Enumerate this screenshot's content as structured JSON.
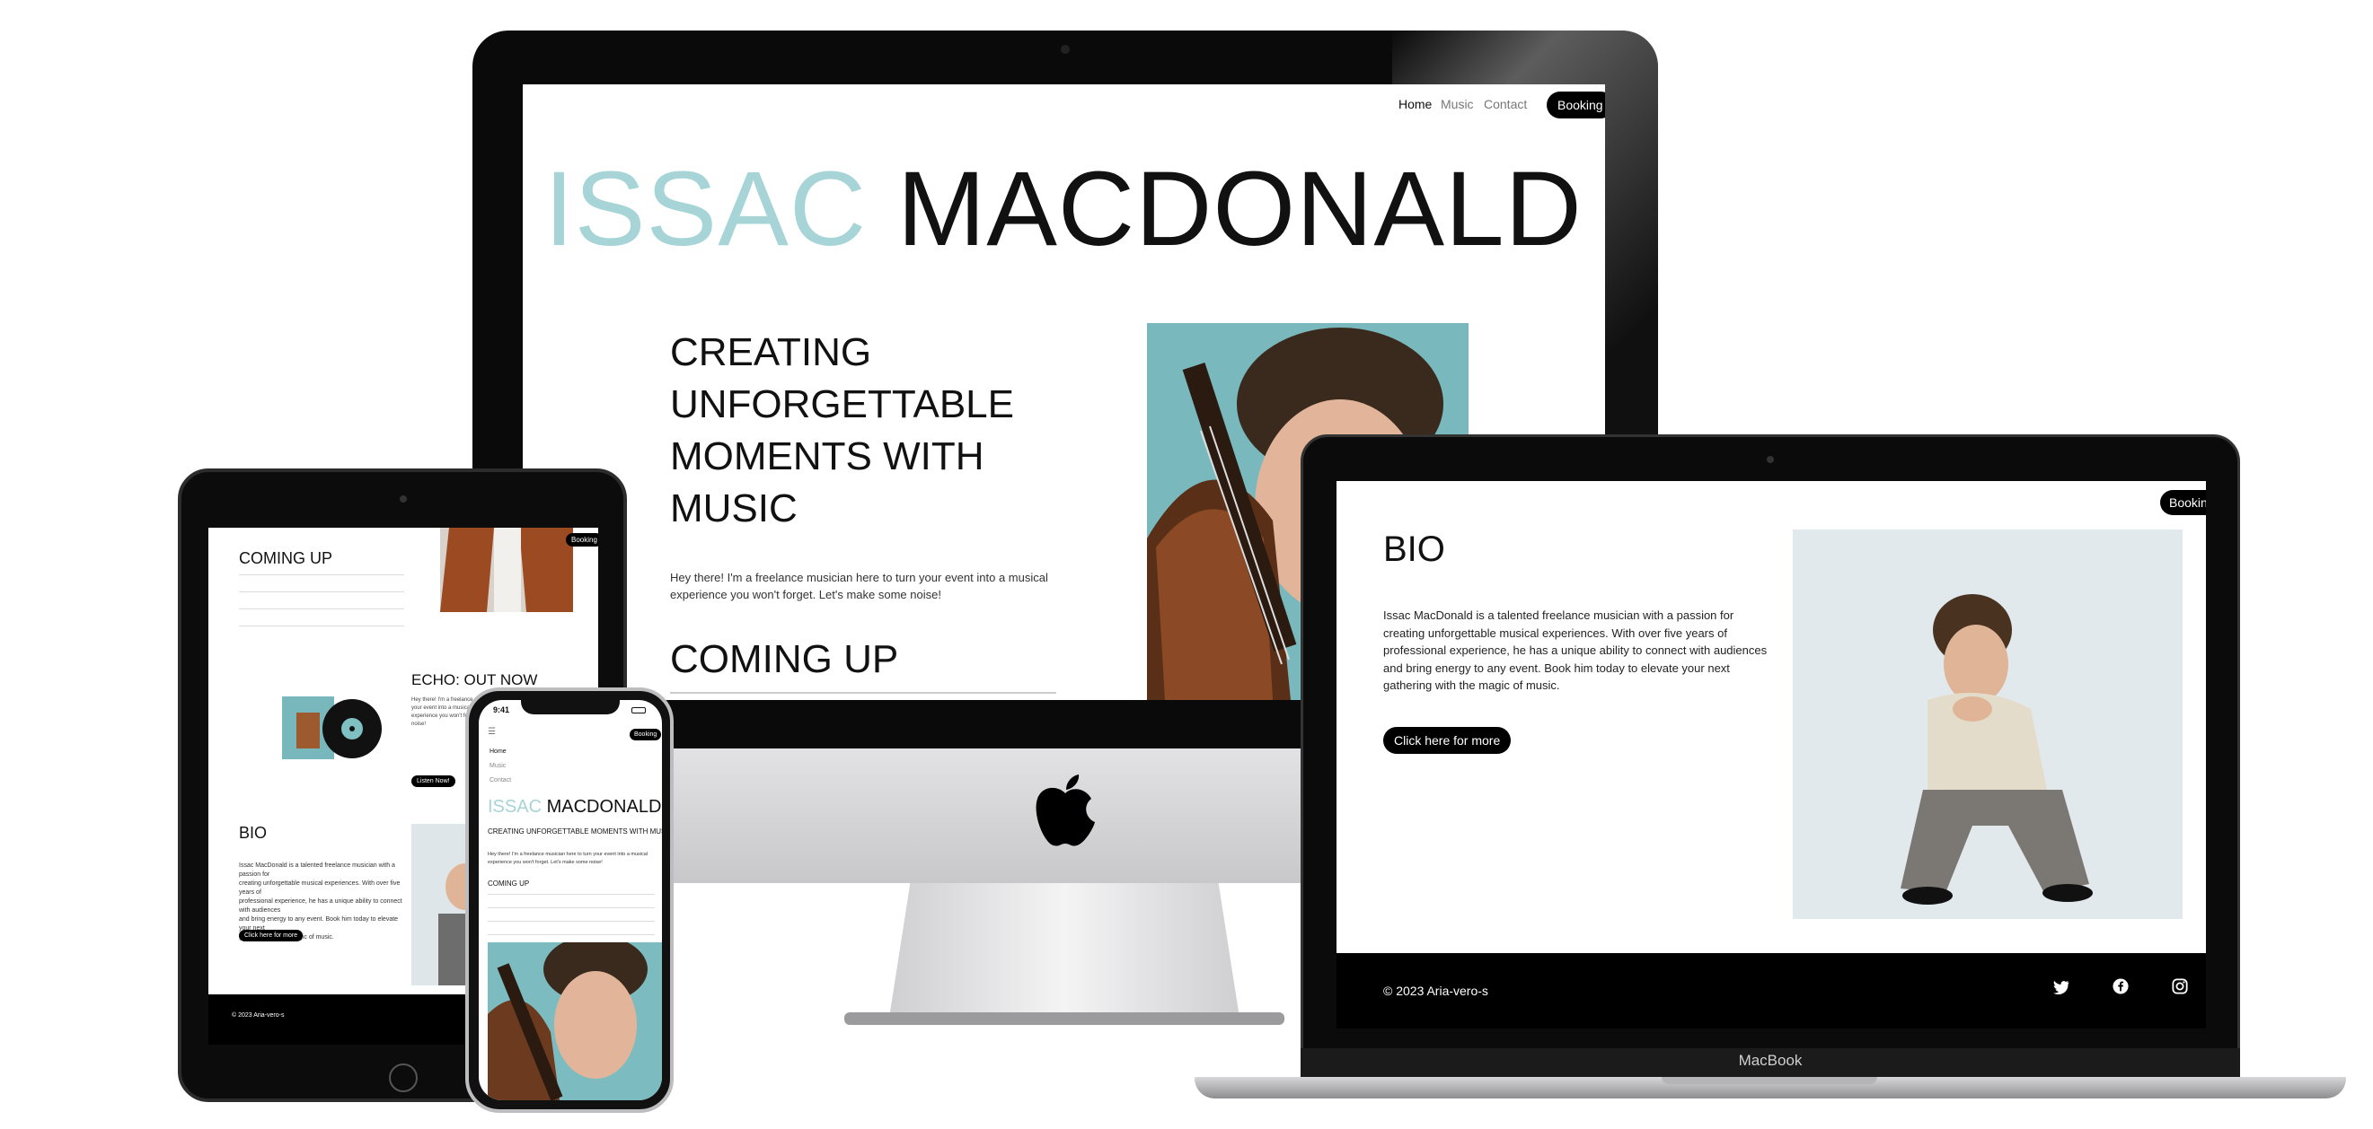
{
  "colors": {
    "accent": "#a7d4d6",
    "dark": "#000000",
    "background": "#ffffff"
  },
  "nav": {
    "home": "Home",
    "music": "Music",
    "contact": "Contact",
    "booking": "Booking"
  },
  "hero": {
    "first_name": "ISSAC",
    "last_name": "MACDONALD",
    "tagline_lines": [
      "CREATING",
      "UNFORGETTABLE",
      "MOMENTS WITH",
      "MUSIC"
    ],
    "tagline": "CREATING UNFORGETTABLE MOMENTS WITH MUSIC",
    "intro_line1": "Hey there! I'm a freelance musician here to turn your event into a musical",
    "intro_line2": "experience you won't forget. Let's make some noise!"
  },
  "coming_up": {
    "title": "COMING UP"
  },
  "echo": {
    "title": "ECHO: OUT NOW",
    "button": "Listen Now!"
  },
  "bio": {
    "title": "BIO",
    "lines": [
      "Issac MacDonald is a talented freelance musician with a passion for",
      "creating unforgettable musical experiences. With over five years of",
      "professional experience, he has a unique ability to connect with audiences",
      "and bring energy to any event. Book him today to elevate your next",
      "gathering with the magic of music."
    ],
    "button": "Click here for more"
  },
  "footer": {
    "copyright": "© 2023 Aria-vero-s",
    "socials": [
      "twitter-icon",
      "facebook-icon",
      "instagram-icon"
    ]
  },
  "iphone_status": {
    "time": "9:41"
  },
  "devices": {
    "macbook_label": "MacBook"
  }
}
